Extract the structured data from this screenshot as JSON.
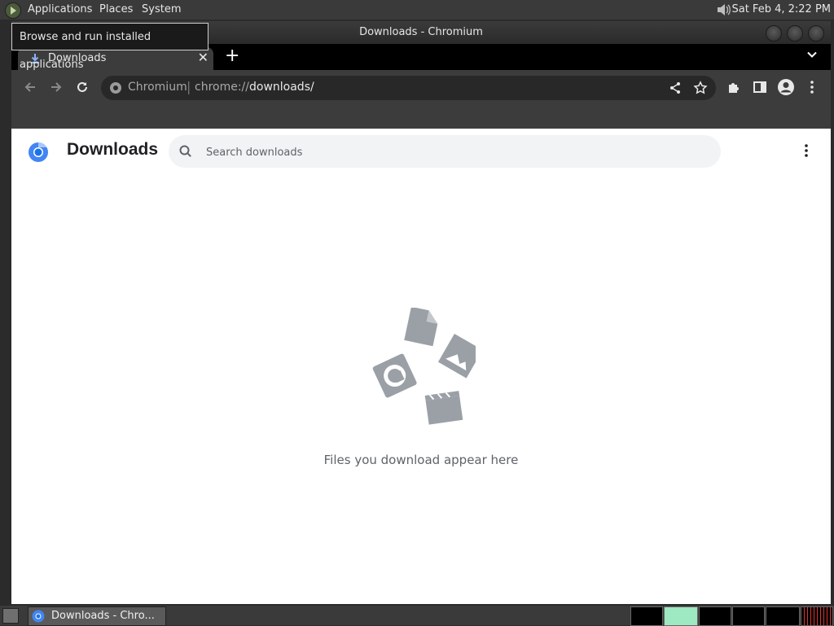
{
  "top_panel": {
    "menus": [
      "Applications",
      "Places",
      "System"
    ],
    "clock": "Sat Feb  4,  2:22 PM"
  },
  "tooltip": "Browse and run installed applications",
  "window": {
    "title": "Downloads - Chromium",
    "tab": {
      "label": "Downloads"
    },
    "omnibox": {
      "site": "Chromium",
      "scheme": "chrome://",
      "path": "downloads/"
    }
  },
  "page": {
    "title": "Downloads",
    "search_placeholder": "Search downloads",
    "empty_message": "Files you download appear here"
  },
  "bottom_panel": {
    "task_label": "Downloads - Chro..."
  },
  "colors": {
    "chrome_dark": "#3c3c3c",
    "accent_blue": "#1a73e8",
    "illustration_gray": "#9aa0a6"
  }
}
